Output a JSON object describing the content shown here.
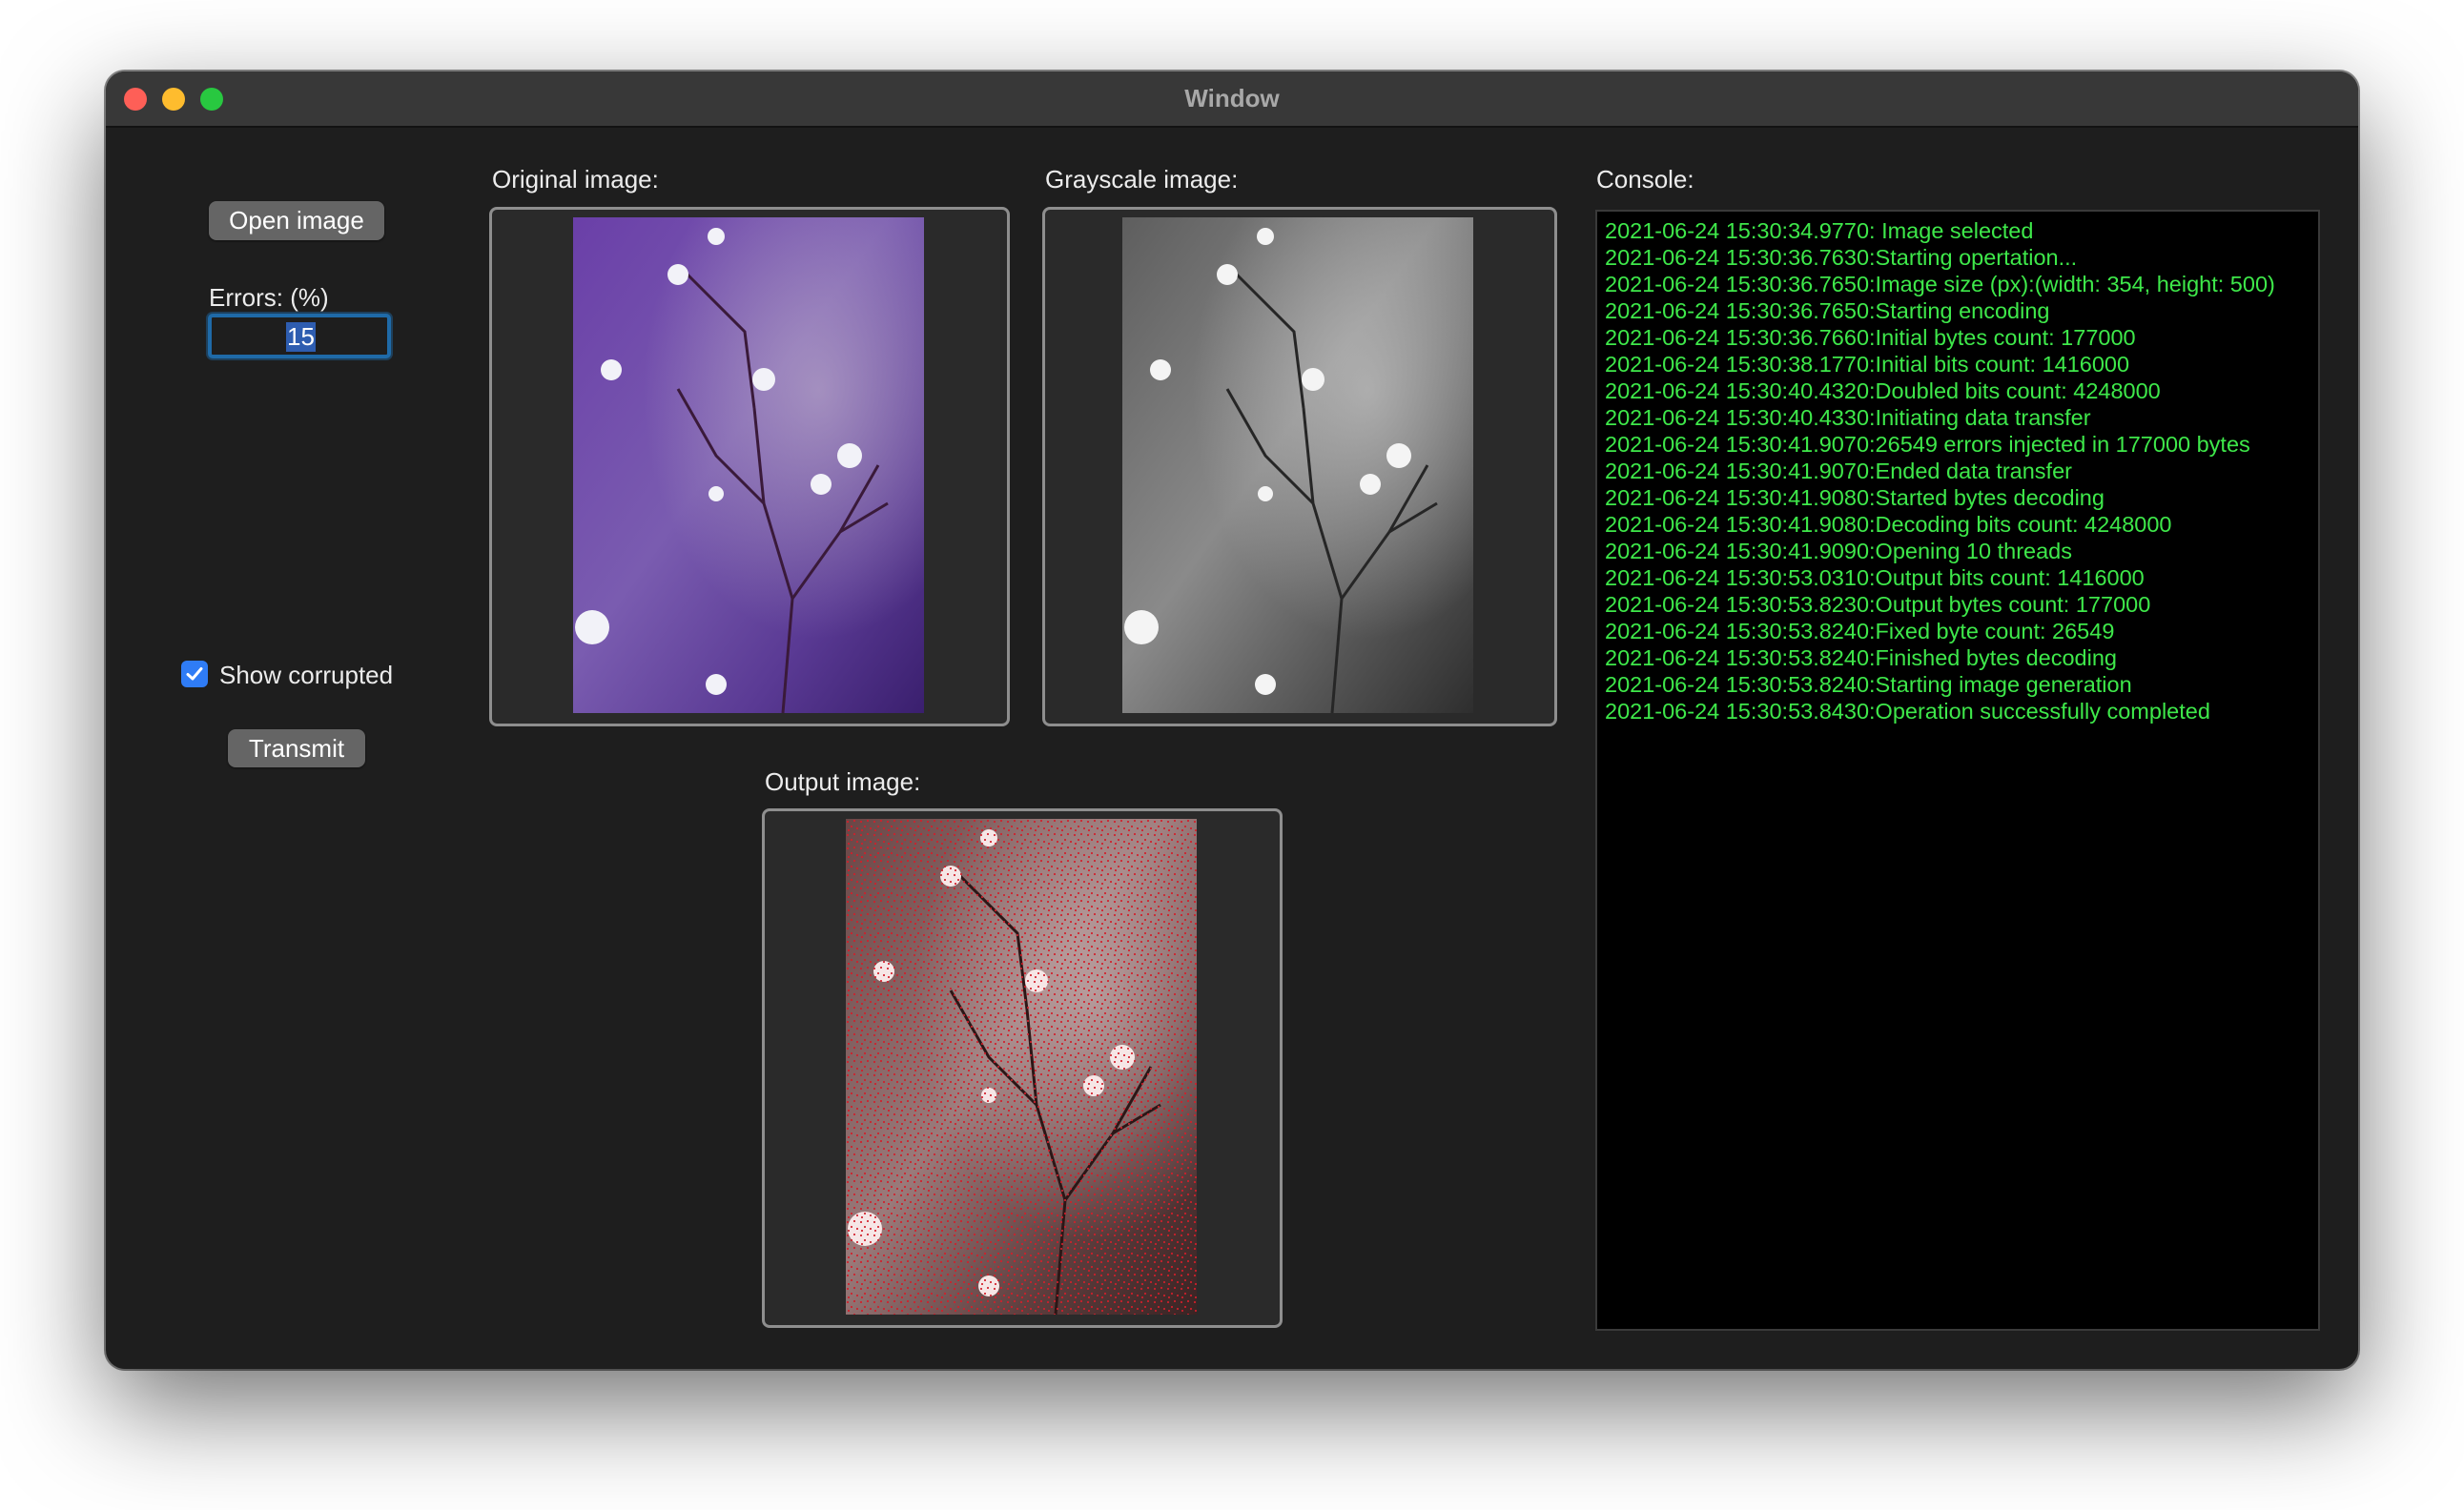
{
  "window": {
    "title": "Window"
  },
  "controls": {
    "open_image_label": "Open image",
    "errors_label": "Errors: (%)",
    "errors_value": "15",
    "show_corrupted_label": "Show corrupted",
    "show_corrupted_checked": true,
    "transmit_label": "Transmit"
  },
  "panels": {
    "original_label": "Original image:",
    "grayscale_label": "Grayscale image:",
    "output_label": "Output image:"
  },
  "console": {
    "label": "Console:",
    "lines": [
      "2021-06-24 15:30:34.9770: Image selected",
      "2021-06-24 15:30:36.7630:Starting opertation...",
      "2021-06-24 15:30:36.7650:Image size (px):(width: 354, height: 500)",
      "2021-06-24 15:30:36.7650:Starting encoding",
      "2021-06-24 15:30:36.7660:Initial bytes count: 177000",
      "2021-06-24 15:30:38.1770:Initial bits count: 1416000",
      "2021-06-24 15:30:40.4320:Doubled bits count: 4248000",
      "2021-06-24 15:30:40.4330:Initiating data transfer",
      "2021-06-24 15:30:41.9070:26549 errors injected in 177000 bytes",
      "2021-06-24 15:30:41.9070:Ended data transfer",
      "2021-06-24 15:30:41.9080:Started bytes decoding",
      "2021-06-24 15:30:41.9080:Decoding bits count: 4248000",
      "2021-06-24 15:30:41.9090:Opening 10 threads",
      "2021-06-24 15:30:53.0310:Output bits count: 1416000",
      "2021-06-24 15:30:53.8230:Output bytes count: 177000",
      "2021-06-24 15:30:53.8240:Fixed byte count: 26549",
      "2021-06-24 15:30:53.8240:Finished bytes decoding",
      "2021-06-24 15:30:53.8240:Starting image generation",
      "2021-06-24 15:30:53.8430:Operation successfully completed"
    ],
    "text_color": "#3ee84a"
  },
  "colors": {
    "window_bg": "#1e1e1e",
    "titlebar_bg": "#383838",
    "accent": "#2f7cf6"
  }
}
